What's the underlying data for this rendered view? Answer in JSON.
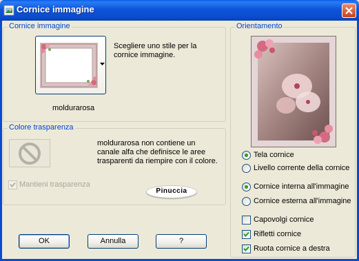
{
  "window": {
    "title": "Cornice immagine"
  },
  "frame_group": {
    "legend": "Cornice immagine",
    "description_line1": "Scegliere uno stile per la",
    "description_line2": "cornice immagine.",
    "selected_frame": "moldurarosa"
  },
  "transparency_group": {
    "legend": "Colore trasparenza",
    "message_line1": "moldurarosa non contiene un",
    "message_line2": "canale alfa che definisce le aree",
    "message_line3": "trasparenti da riempire con il colore.",
    "keep_transparency_label": "Mantieni trasparenza",
    "keep_transparency_checked": true,
    "signature": "Pinuccia"
  },
  "orientation_group": {
    "legend": "Orientamento",
    "target_options": [
      {
        "label": "Tela cornice",
        "selected": true
      },
      {
        "label": "Livello corrente della cornice",
        "selected": false
      }
    ],
    "placement_options": [
      {
        "label": "Cornice interna all'immagine",
        "selected": true
      },
      {
        "label": "Cornice esterna all'immagine",
        "selected": false
      }
    ],
    "checkboxes": [
      {
        "label": "Capovolgi cornice",
        "checked": false
      },
      {
        "label": "Rifletti cornice",
        "checked": true
      },
      {
        "label": "Ruota cornice a destra",
        "checked": true
      }
    ]
  },
  "buttons": {
    "ok": "OK",
    "cancel": "Annulla",
    "help": "?"
  },
  "colors": {
    "title_blue": "#0a4bcf",
    "group_label": "#0046d5",
    "check_green": "#21a121"
  }
}
